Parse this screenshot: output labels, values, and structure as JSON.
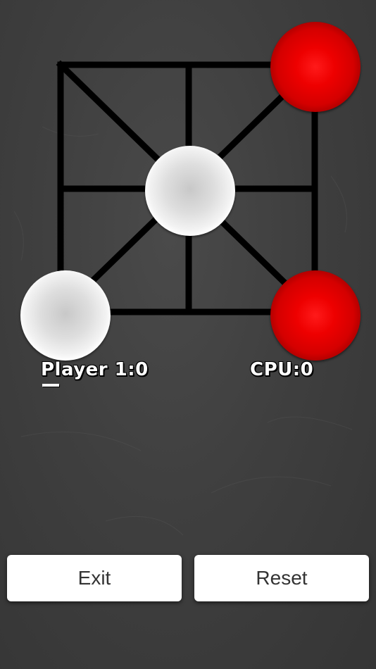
{
  "game": {
    "board_nodes": [
      "top-left",
      "top-center",
      "top-right",
      "middle-left",
      "center",
      "middle-right",
      "bottom-left",
      "bottom-center",
      "bottom-right"
    ],
    "pieces": [
      {
        "node": "top-right",
        "owner": "cpu",
        "color": "red"
      },
      {
        "node": "center",
        "owner": "player",
        "color": "white"
      },
      {
        "node": "bottom-left",
        "owner": "player",
        "color": "white"
      },
      {
        "node": "bottom-right",
        "owner": "cpu",
        "color": "red"
      }
    ]
  },
  "scores": {
    "player_label": "Player 1:0",
    "cpu_label": "CPU:0"
  },
  "buttons": {
    "exit_label": "Exit",
    "reset_label": "Reset"
  },
  "colors": {
    "background": "#3f3f3f",
    "board_lines": "#000000",
    "player_piece": "#f0f0f0",
    "cpu_piece": "#e00000",
    "button_bg": "#ffffff"
  }
}
